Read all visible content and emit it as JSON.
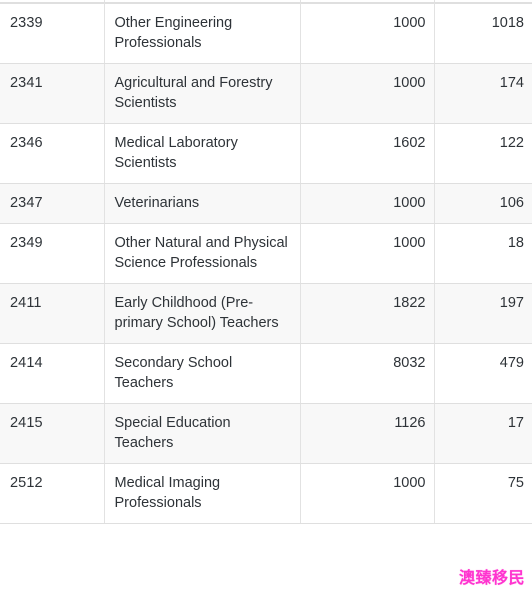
{
  "table": {
    "columns": [
      {
        "key": "code",
        "name": "occupation-code"
      },
      {
        "key": "name",
        "name": "occupation-name"
      },
      {
        "key": "quota",
        "name": "occupation-quota"
      },
      {
        "key": "count",
        "name": "occupation-count"
      }
    ],
    "rows": [
      {
        "code": "2339",
        "name": "Other Engineering Professionals",
        "quota": "1000",
        "count": "1018"
      },
      {
        "code": "2341",
        "name": "Agricultural and Forestry Scientists",
        "quota": "1000",
        "count": "174"
      },
      {
        "code": "2346",
        "name": "Medical Laboratory Scientists",
        "quota": "1602",
        "count": "122"
      },
      {
        "code": "2347",
        "name": "Veterinarians",
        "quota": "1000",
        "count": "106"
      },
      {
        "code": "2349",
        "name": "Other Natural and Physical Science Professionals",
        "quota": "1000",
        "count": "18"
      },
      {
        "code": "2411",
        "name": "Early Childhood (Pre-primary School) Teachers",
        "quota": "1822",
        "count": "197"
      },
      {
        "code": "2414",
        "name": "Secondary School Teachers",
        "quota": "8032",
        "count": "479"
      },
      {
        "code": "2415",
        "name": "Special Education Teachers",
        "quota": "1126",
        "count": "17"
      },
      {
        "code": "2512",
        "name": "Medical Imaging Professionals",
        "quota": "1000",
        "count": "75"
      }
    ]
  },
  "watermark": {
    "text": "澳臻移民",
    "color": "#ff35cf"
  },
  "style": {
    "row_stripe_color": "#f8f8f8",
    "row_base_color": "#ffffff",
    "border_color": "#dfdfdf",
    "text_color": "#2e3338"
  }
}
